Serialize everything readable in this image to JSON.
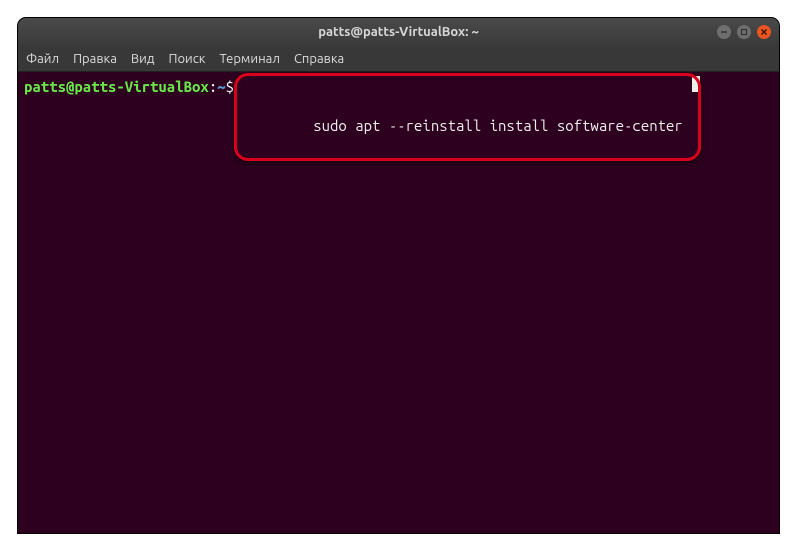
{
  "window": {
    "title": "patts@patts-VirtualBox: ~"
  },
  "menu": {
    "file": "Файл",
    "edit": "Правка",
    "view": "Вид",
    "search": "Поиск",
    "terminal": "Терминал",
    "help": "Справка"
  },
  "prompt": {
    "userhost": "patts@patts-VirtualBox",
    "colon": ":",
    "path": "~",
    "dollar": "$"
  },
  "command": "sudo apt --reinstall install software-center"
}
